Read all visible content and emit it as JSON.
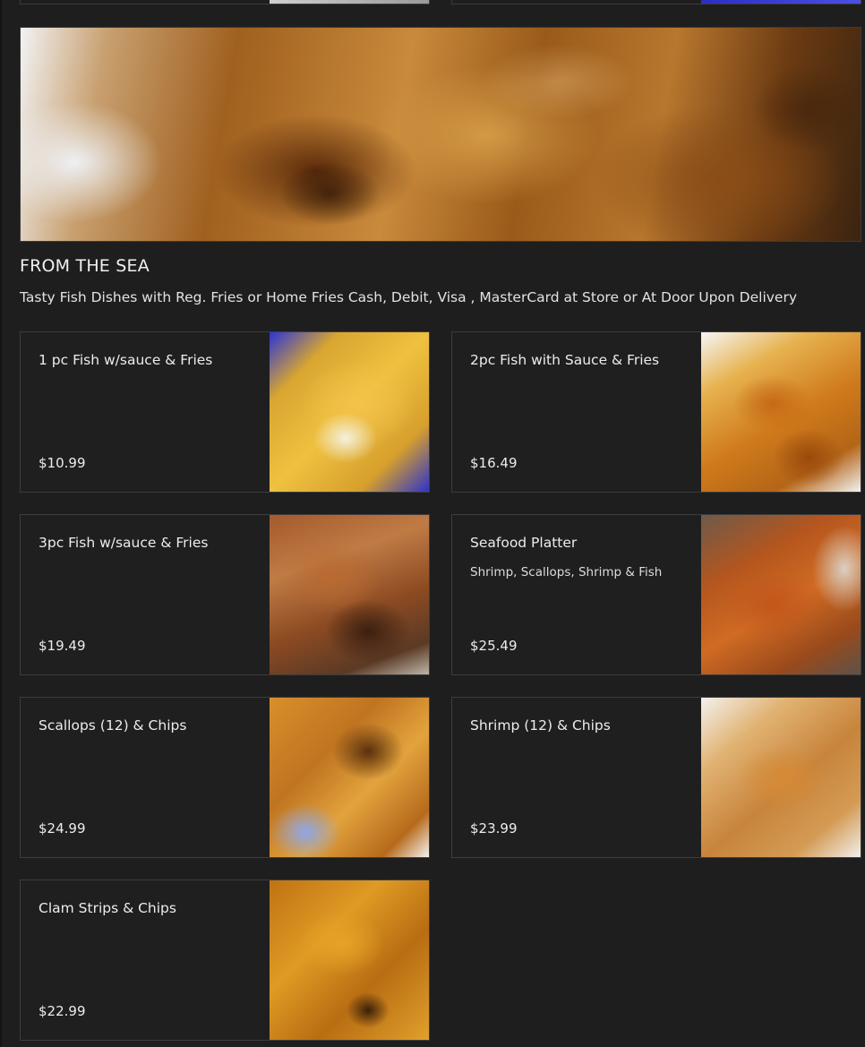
{
  "section": {
    "title": "FROM THE SEA",
    "description": "Tasty Fish Dishes with Reg. Fries or Home Fries Cash, Debit, Visa , MasterCard at Store or At Door Upon Delivery"
  },
  "items": [
    {
      "name": "1 pc Fish w/sauce & Fries",
      "description": "",
      "price": "$10.99",
      "image": "fish-and-fries-photo"
    },
    {
      "name": "2pc Fish with Sauce & Fries",
      "description": "",
      "price": "$16.49",
      "image": "fried-rings-photo"
    },
    {
      "name": "3pc Fish w/sauce & Fries",
      "description": "",
      "price": "$19.49",
      "image": "fried-fish-photo"
    },
    {
      "name": "Seafood Platter",
      "description": "Shrimp, Scallops, Shrimp & Fish",
      "price": "$25.49",
      "image": "seafood-platter-photo"
    },
    {
      "name": "Scallops (12) & Chips",
      "description": "",
      "price": "$24.99",
      "image": "scallops-photo"
    },
    {
      "name": "Shrimp (12) & Chips",
      "description": "",
      "price": "$23.99",
      "image": "shrimp-photo"
    },
    {
      "name": "Clam Strips & Chips",
      "description": "",
      "price": "$22.99",
      "image": "clam-strips-photo"
    }
  ],
  "colors": {
    "background": "#1e1e1e",
    "card_border": "#3d3d3d",
    "text": "#ececec"
  }
}
